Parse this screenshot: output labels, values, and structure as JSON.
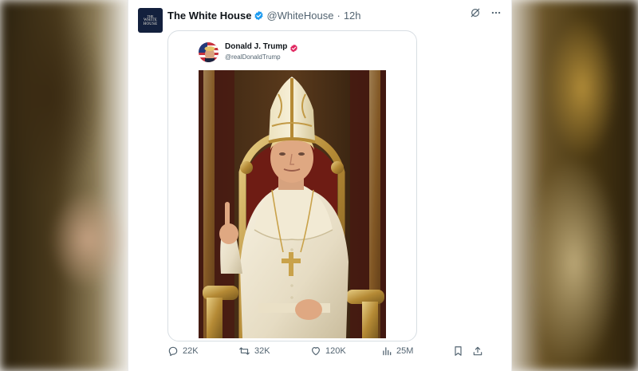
{
  "tweet": {
    "author_name": "The White House",
    "handle": "@WhiteHouse",
    "separator": "·",
    "time": "12h",
    "avatar_text": [
      "THE",
      "WHITE",
      "HOUSE"
    ]
  },
  "quoted": {
    "author_name": "Donald J. Trump",
    "handle": "@realDonaldTrump"
  },
  "actions": {
    "replies": "22K",
    "reposts": "32K",
    "likes": "120K",
    "views": "25M"
  },
  "colors": {
    "verified_blue": "#1d9bf0",
    "verified_pink": "#e0245e",
    "text_primary": "#0f1419",
    "text_secondary": "#536471"
  },
  "icons": {
    "verified": "verified-badge-icon",
    "grok": "grok-icon",
    "more": "more-icon",
    "reply": "reply-icon",
    "repost": "repost-icon",
    "like": "heart-icon",
    "views": "views-icon",
    "bookmark": "bookmark-icon",
    "share": "share-icon"
  }
}
